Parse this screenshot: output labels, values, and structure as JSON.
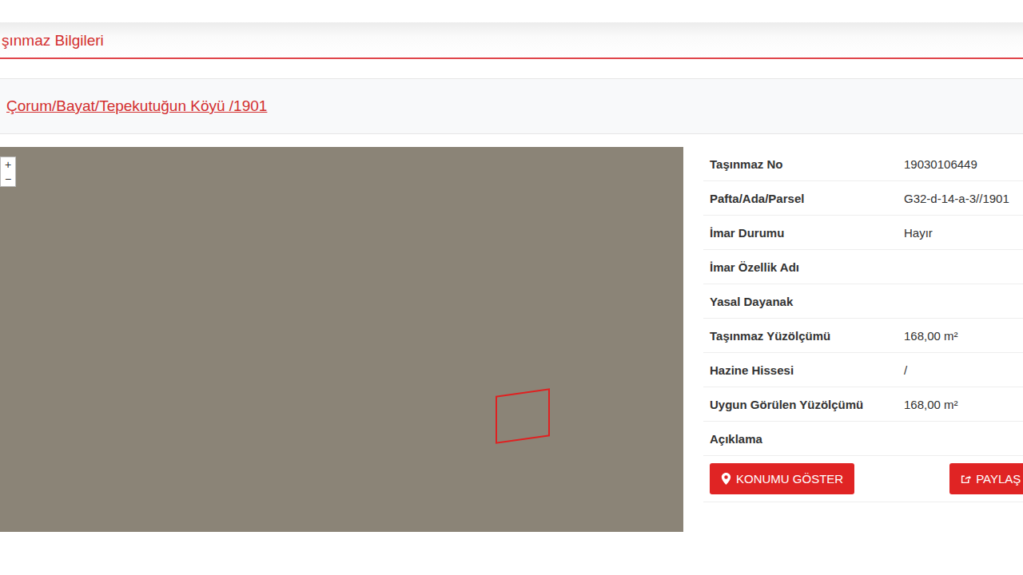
{
  "header": {
    "title": "şınmaz Bilgileri"
  },
  "location": {
    "path": "Çorum/Bayat/Tepekutuğun Köyü /1901"
  },
  "map": {
    "zoom_in": "+",
    "zoom_out": "−"
  },
  "details": [
    {
      "label": "Taşınmaz No",
      "value": "19030106449"
    },
    {
      "label": "Pafta/Ada/Parsel",
      "value": "G32-d-14-a-3//1901"
    },
    {
      "label": "İmar Durumu",
      "value": "Hayır"
    },
    {
      "label": "İmar Özellik Adı",
      "value": ""
    },
    {
      "label": "Yasal Dayanak",
      "value": ""
    },
    {
      "label": "Taşınmaz Yüzölçümü",
      "value": "168,00 m²"
    },
    {
      "label": "Hazine Hissesi",
      "value": "/"
    },
    {
      "label": "Uygun Görülen Yüzölçümü",
      "value": "168,00 m²"
    },
    {
      "label": "Açıklama",
      "value": ""
    }
  ],
  "buttons": [
    {
      "label": "KONUMU GÖSTER"
    },
    {
      "label": "PAYLAŞ"
    }
  ]
}
